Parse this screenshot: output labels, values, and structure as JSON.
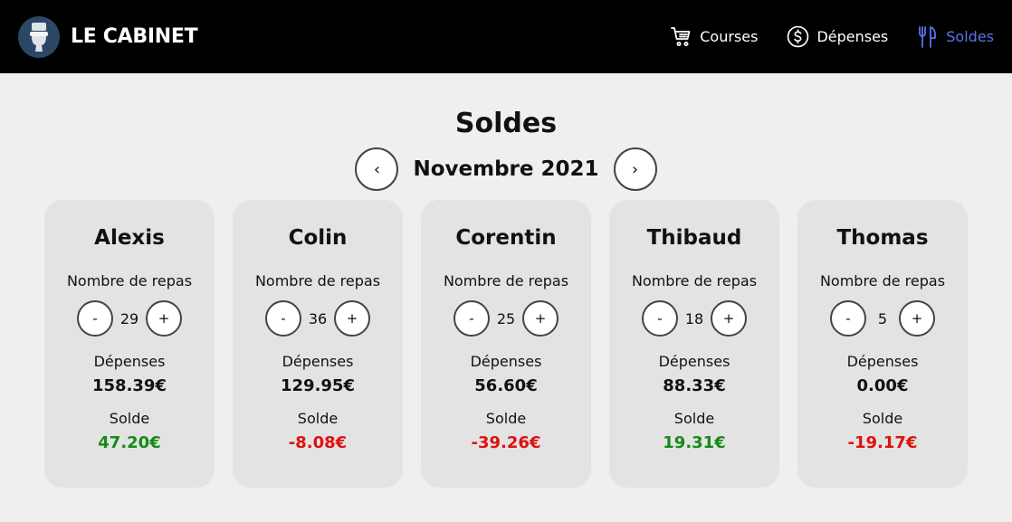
{
  "app": {
    "name": "LE CABINET",
    "logo_icon": "toilet-icon"
  },
  "nav": [
    {
      "label": "Courses",
      "icon": "shopping-cart-icon",
      "active": false
    },
    {
      "label": "Dépenses",
      "icon": "dollar-circle-icon",
      "active": false
    },
    {
      "label": "Soldes",
      "icon": "fork-knife-icon",
      "active": true
    }
  ],
  "colors": {
    "topbar": "#000000",
    "active_nav": "#5b74e8",
    "positive": "#168a16",
    "negative": "#e01010",
    "card_bg": "#e3e3e3"
  },
  "page": {
    "title": "Soldes",
    "month": "Novembre 2021",
    "prev_label": "‹",
    "next_label": "›"
  },
  "labels": {
    "meals": "Nombre de repas",
    "expenses": "Dépenses",
    "balance": "Solde",
    "minus": "-",
    "plus": "+"
  },
  "members": [
    {
      "name": "Alexis",
      "meals": "29",
      "expenses": "158.39€",
      "balance": "47.20€",
      "status": "positive"
    },
    {
      "name": "Colin",
      "meals": "36",
      "expenses": "129.95€",
      "balance": "-8.08€",
      "status": "negative"
    },
    {
      "name": "Corentin",
      "meals": "25",
      "expenses": "56.60€",
      "balance": "-39.26€",
      "status": "negative"
    },
    {
      "name": "Thibaud",
      "meals": "18",
      "expenses": "88.33€",
      "balance": "19.31€",
      "status": "positive"
    },
    {
      "name": "Thomas",
      "meals": "5",
      "expenses": "0.00€",
      "balance": "-19.17€",
      "status": "negative"
    }
  ]
}
